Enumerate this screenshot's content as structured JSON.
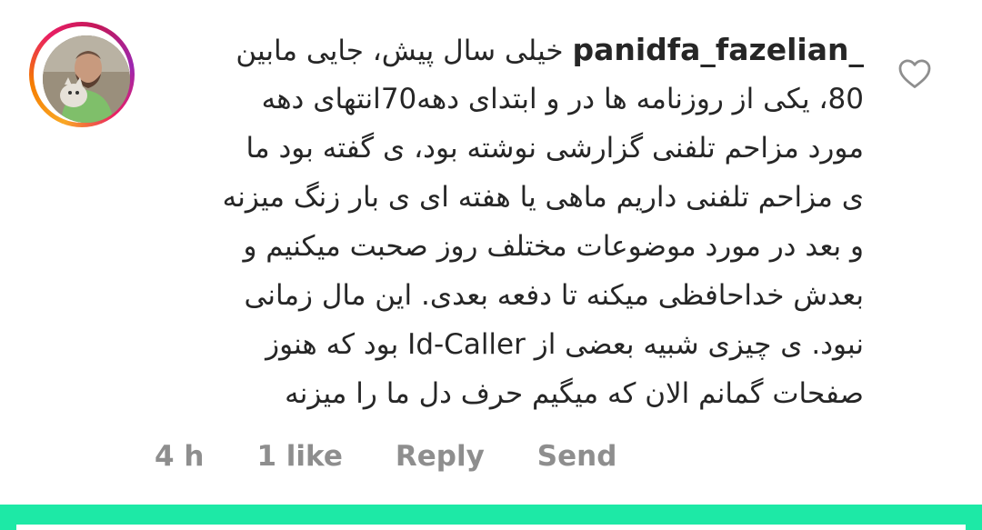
{
  "comment": {
    "username": "panidfa_fazelian_",
    "lines": [
      "خیلی سال پیش، جایی مابین",
      "80، یکی از روزنامه ها در و ابتدای دهه70انتهای دهه",
      "مورد مزاحم تلفنی گزارشی نوشته بود، ی گفته بود ما",
      "ی مزاحم تلفنی داریم ماهی یا هفته ای ی بار زنگ میزنه",
      "و بعد در مورد موضوعات مختلف روز صحبت میکنیم و",
      "بعدش خداحافظی میکنه تا دفعه بعدی. این مال زمانی",
      "نبود. ی چیزی شبیه بعضی از Id-Caller بود که هنوز",
      "صفحات گمانم الان که میگیم حرف دل ما را میزنه"
    ]
  },
  "actions": {
    "time": "4 h",
    "likes": "1 like",
    "reply": "Reply",
    "send": "Send"
  },
  "icons": {
    "like": "heart-outline-icon"
  },
  "colors": {
    "text": "#262626",
    "muted": "#8e8e8e",
    "bottom_bar": "#1de9a6"
  }
}
